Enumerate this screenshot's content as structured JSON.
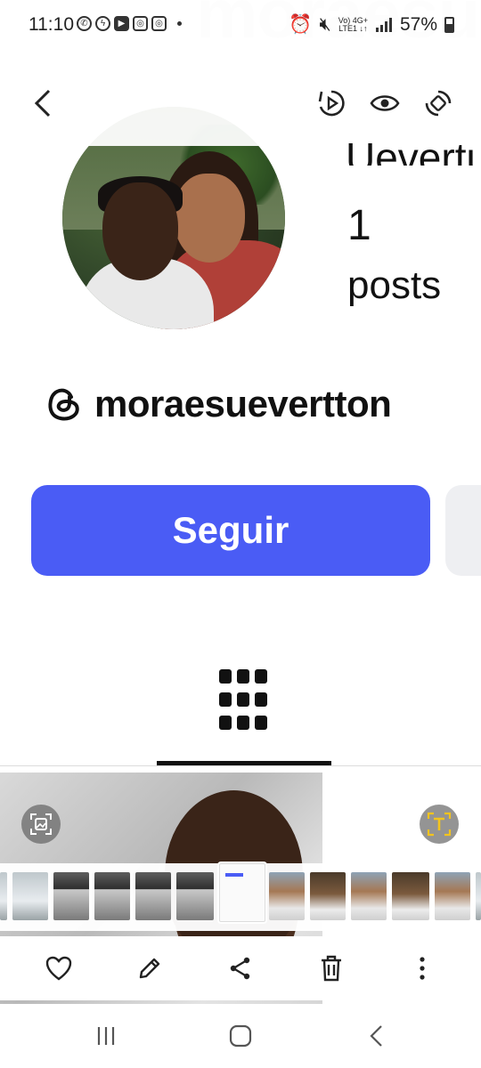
{
  "status_bar": {
    "time": "11:10",
    "notification_icons": [
      "whatsapp-icon",
      "messenger-icon",
      "youtube-icon",
      "instagram-icon",
      "instagram-icon"
    ],
    "network_line1": "Vo) 4G+",
    "network_line2": "LTE1 ↓↑",
    "battery": "57%"
  },
  "profile": {
    "watermark_text": "moraesuev",
    "name_partial": "Uevertu",
    "posts_count": "1",
    "posts_label": "posts",
    "threads_handle": "moraesuevertton",
    "follow_label": "Seguir"
  },
  "header_icons": [
    "back-icon",
    "playback-icon",
    "eye-icon",
    "rotate-icon"
  ],
  "toolbar_icons": [
    "heart-icon",
    "edit-pencil-icon",
    "share-icon",
    "trash-icon",
    "more-vertical-icon"
  ],
  "nav_keys": [
    "recent-apps-icon",
    "home-icon",
    "back-icon"
  ],
  "colors": {
    "follow_button": "#4a5cf5",
    "text_primary": "#111111",
    "text_icon_yellow": "#f3c41d"
  }
}
